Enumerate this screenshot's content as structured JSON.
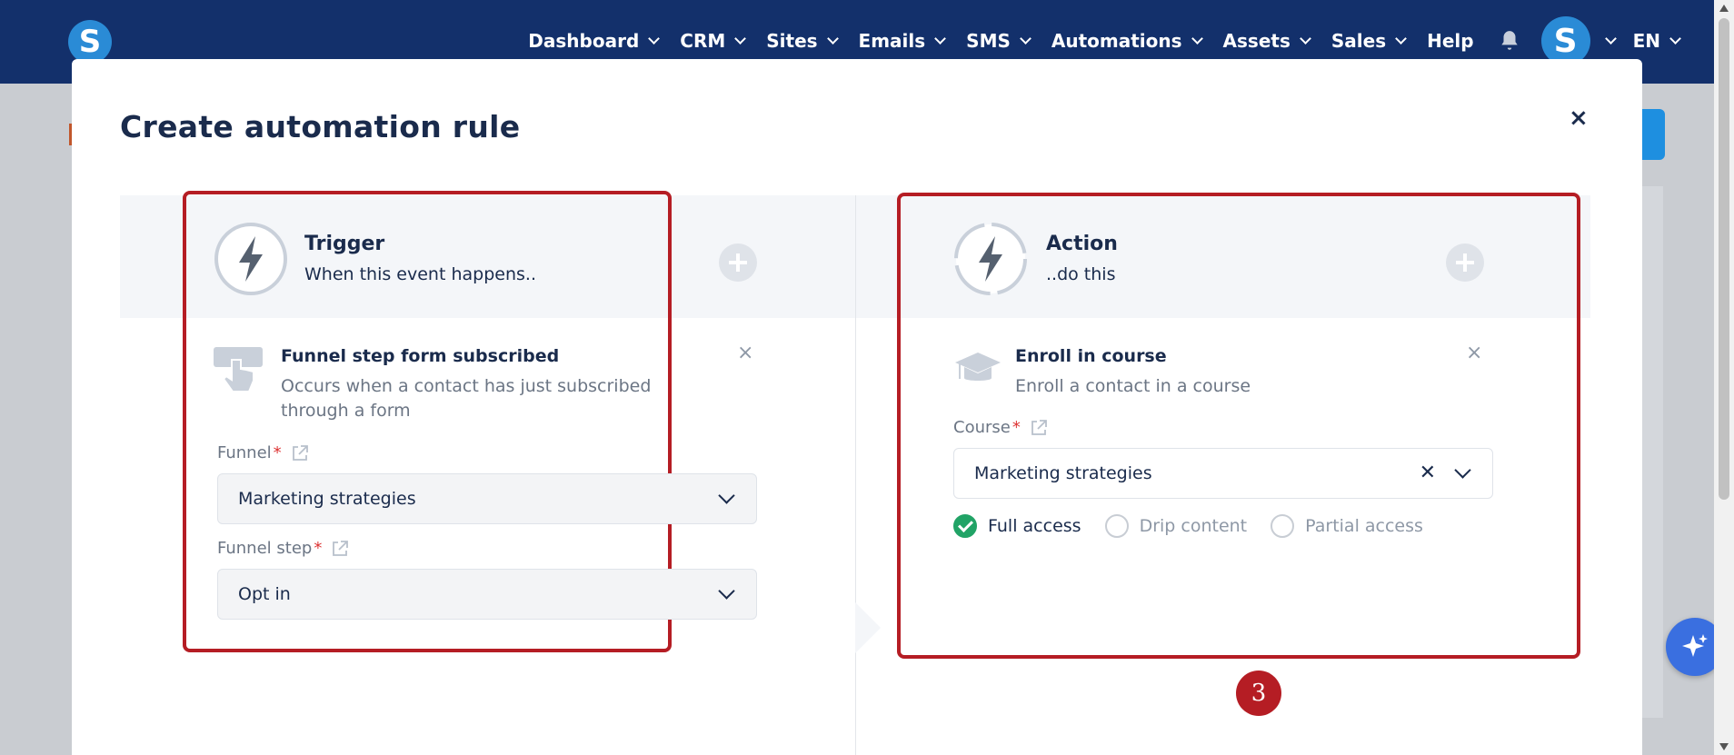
{
  "nav": {
    "logo": "S",
    "items": [
      {
        "label": "Dashboard",
        "dropdown": true
      },
      {
        "label": "CRM",
        "dropdown": true
      },
      {
        "label": "Sites",
        "dropdown": true
      },
      {
        "label": "Emails",
        "dropdown": true
      },
      {
        "label": "SMS",
        "dropdown": true
      },
      {
        "label": "Automations",
        "dropdown": true
      },
      {
        "label": "Assets",
        "dropdown": true
      },
      {
        "label": "Sales",
        "dropdown": true
      },
      {
        "label": "Help",
        "dropdown": false
      }
    ],
    "avatar": "S",
    "language": "EN"
  },
  "modal": {
    "title": "Create automation rule",
    "close": "×",
    "trigger": {
      "title": "Trigger",
      "subtitle": "When this event happens..",
      "card": {
        "title": "Funnel step form subscribed",
        "description": "Occurs when a contact has just subscribed through a form",
        "remove": "×"
      },
      "fields": [
        {
          "label": "Funnel",
          "required": "*",
          "value": "Marketing strategies"
        },
        {
          "label": "Funnel step",
          "required": "*",
          "value": "Opt in"
        }
      ]
    },
    "action": {
      "title": "Action",
      "subtitle": "..do this",
      "card": {
        "title": "Enroll in course",
        "description": "Enroll a contact in a course",
        "remove": "×"
      },
      "course_field": {
        "label": "Course",
        "required": "*",
        "value": "Marketing strategies",
        "clear": "✕"
      },
      "access_options": [
        {
          "label": "Full access",
          "checked": true
        },
        {
          "label": "Drip content",
          "checked": false
        },
        {
          "label": "Partial access",
          "checked": false
        }
      ]
    }
  },
  "step_badge": "3",
  "colors": {
    "nav_bg": "#13306b",
    "highlight": "#b51d24",
    "check": "#21a366",
    "primary": "#1a2b4c"
  }
}
